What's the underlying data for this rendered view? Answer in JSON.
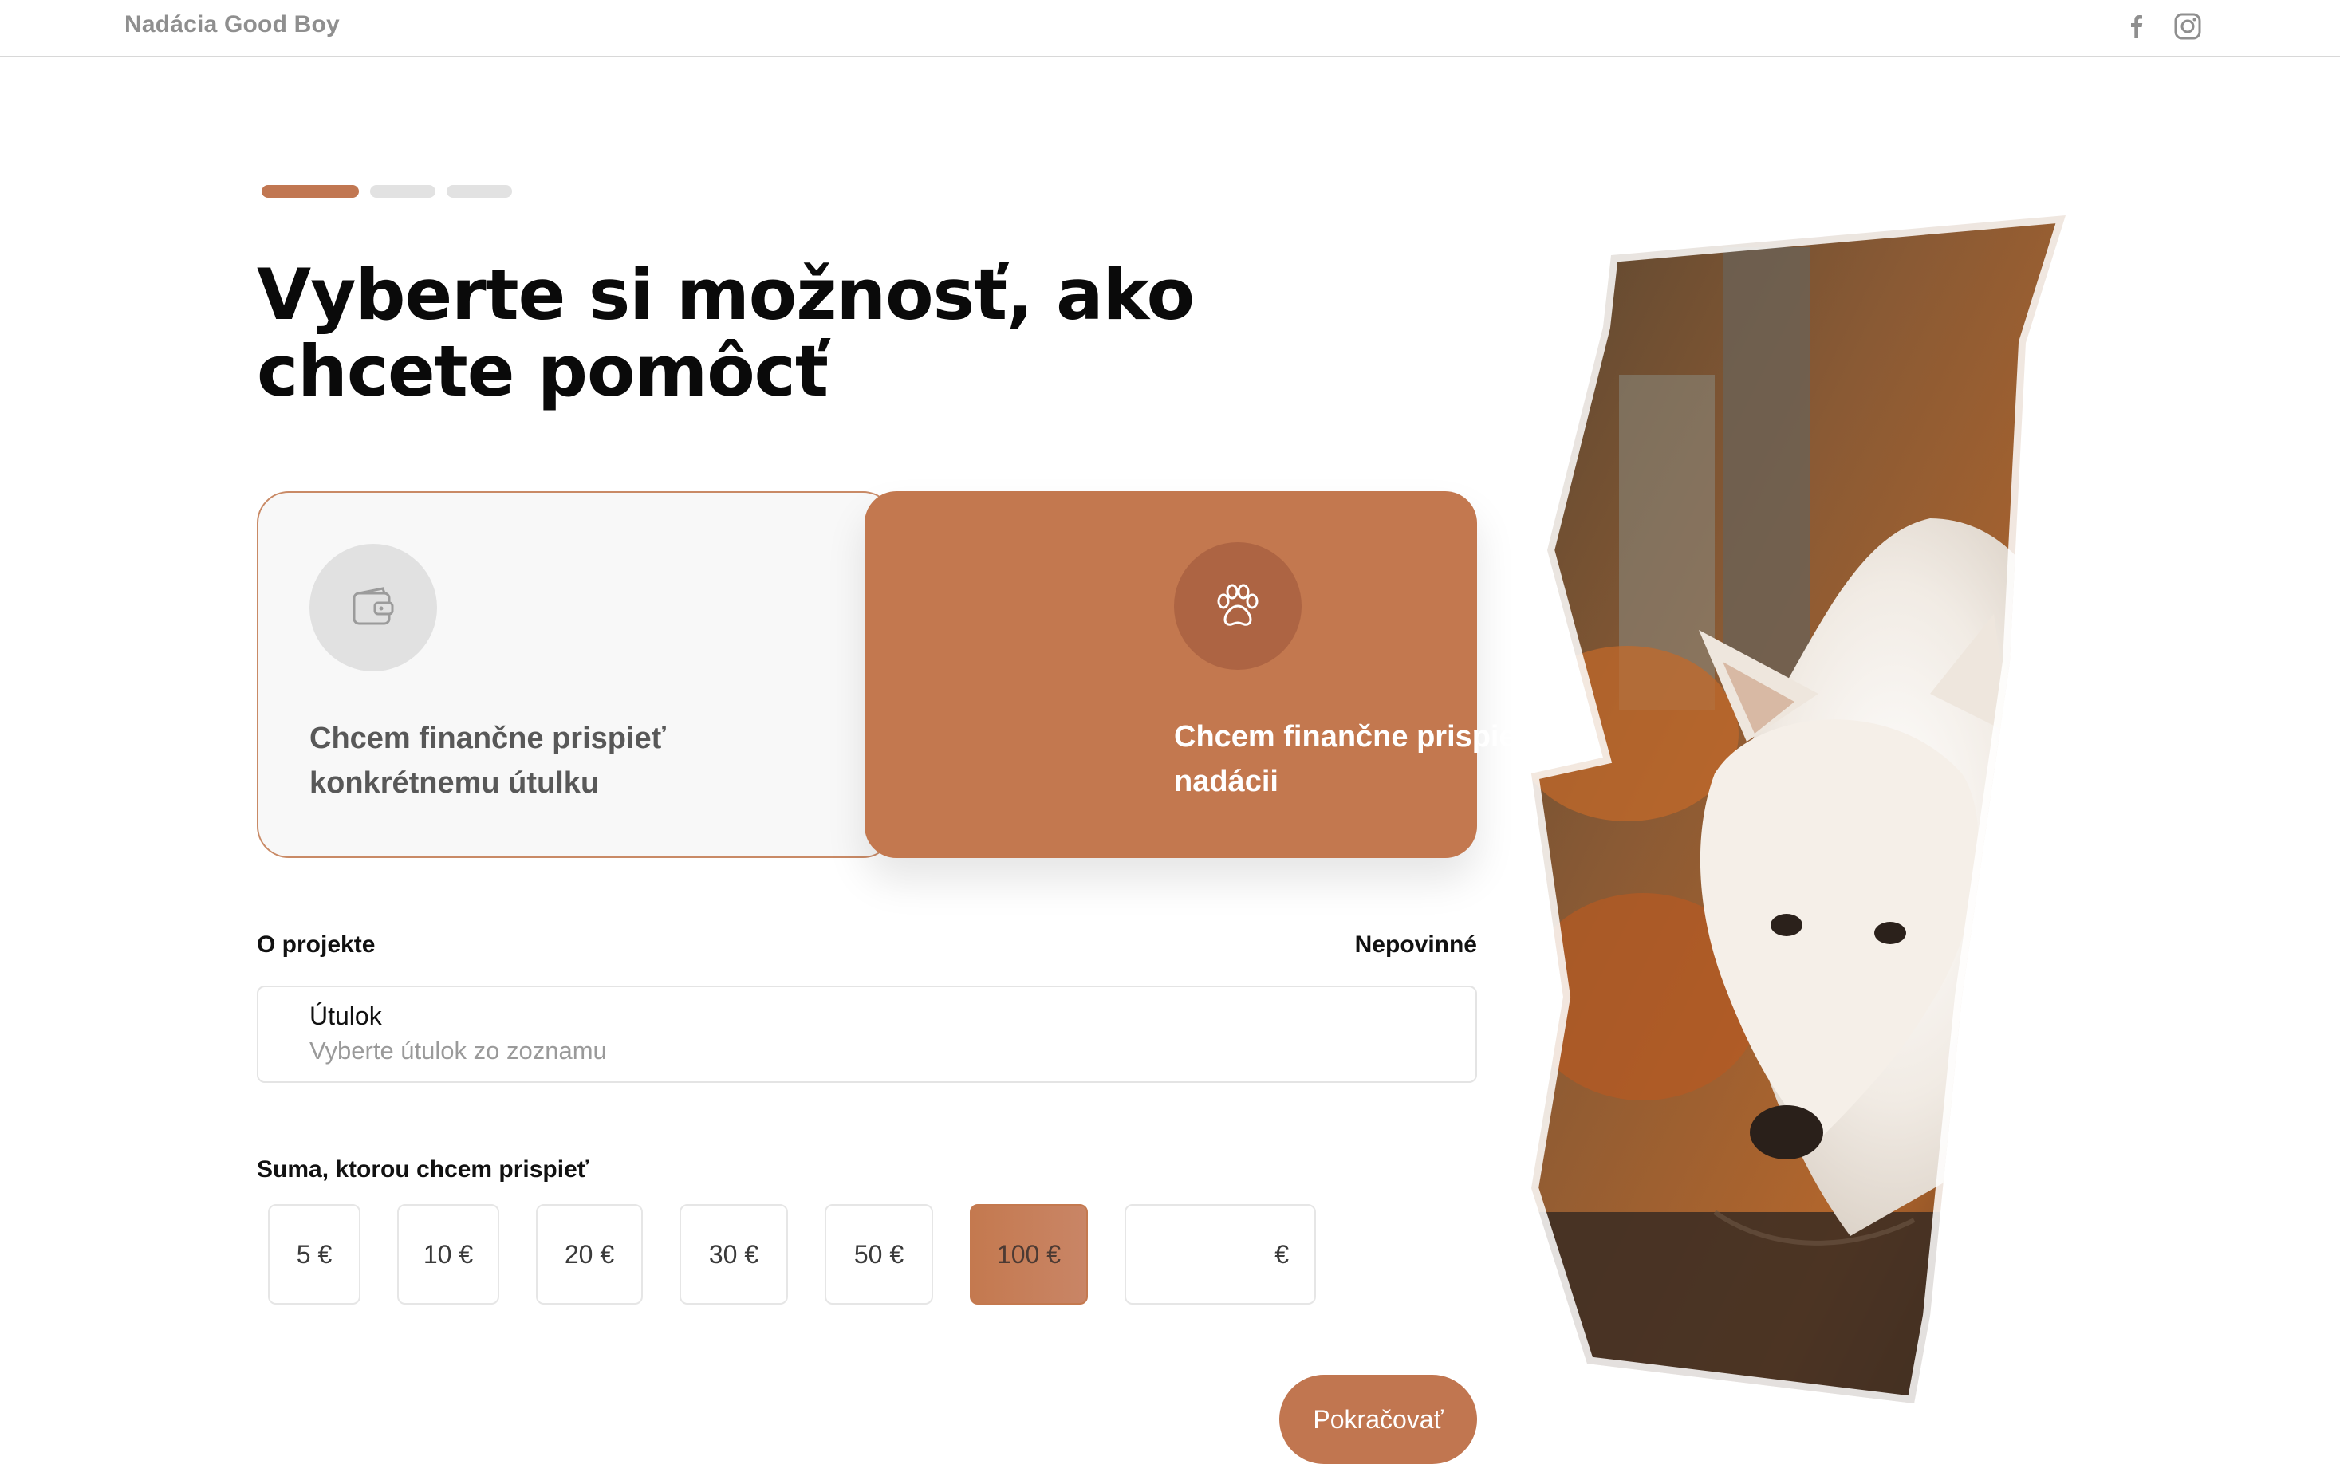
{
  "header": {
    "brand": "Nadácia Good Boy",
    "social": [
      {
        "icon": "facebook-icon"
      },
      {
        "icon": "instagram-icon"
      }
    ]
  },
  "stepper": {
    "total_steps": 3,
    "current_step": 1,
    "active_color": "#c17752",
    "inactive_color": "#e2e2e2"
  },
  "page": {
    "title": "Vyberte si možnosť, ako chcete pomôcť"
  },
  "options": [
    {
      "label": "Chcem finančne prispieť konkrétnemu útulku",
      "icon": "wallet-icon",
      "selected": false
    },
    {
      "label": "Chcem finančne prispieť celej nadácii",
      "icon": "paw-icon",
      "selected": true
    }
  ],
  "project": {
    "label": "O projekte",
    "optional": "Nepovinné",
    "field_title": "Útulok",
    "field_placeholder": "Vyberte útulok zo zoznamu"
  },
  "amount": {
    "label": "Suma, ktorou chcem prispieť",
    "options": [
      "5 €",
      "10 €",
      "20 €",
      "30 €",
      "50 €",
      "100 €"
    ],
    "selected": "100 €",
    "custom_currency": "€"
  },
  "actions": {
    "continue": "Pokračovať"
  },
  "colors": {
    "accent": "#c3784f",
    "accent_dark": "#ad6443",
    "border": "#e4e4e4"
  }
}
